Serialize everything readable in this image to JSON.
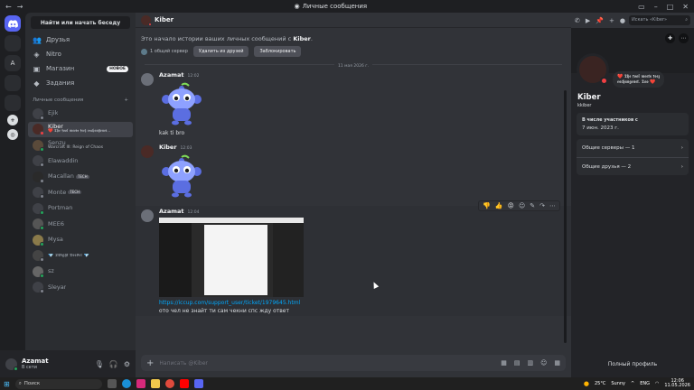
{
  "titlebar": {
    "title": "Личные сообщения"
  },
  "sidebar": {
    "search_button": "Найти или начать беседу",
    "nav": [
      {
        "label": "Друзья",
        "icon": "friends-icon"
      },
      {
        "label": "Nitro",
        "icon": "nitro-icon"
      },
      {
        "label": "Магазин",
        "icon": "shop-icon",
        "badge": "НОВОЕ"
      },
      {
        "label": "Задания",
        "icon": "quests-icon"
      }
    ],
    "dm_header": "Личные сообщения",
    "dms": [
      {
        "name": "Ejik",
        "status": "offline"
      },
      {
        "name": "Kiber",
        "sub": "❤️ 𝕿𝖍𝖊 𝖋𝖔𝖔𝖑 𝖒𝖊𝖊𝖙𝖘 𝖋𝖊𝖊𝖟 𝖊𝖘𝖈𝖍𝖆𝖓𝖌𝖊𝖓𝖊𝖙...",
        "status": "dnd",
        "active": true
      },
      {
        "name": "Senzu",
        "sub": "Warcraft III: Reign of Chaos",
        "status": "online"
      },
      {
        "name": "Elawaddin",
        "status": "offline"
      },
      {
        "name": "Macallan",
        "tag": "TECH",
        "status": "offline"
      },
      {
        "name": "Monte",
        "tag": "TECH",
        "status": "offline"
      },
      {
        "name": "Portman",
        "status": "online"
      },
      {
        "name": "MEE6",
        "status": "online"
      },
      {
        "name": "Mysa",
        "status": "online"
      },
      {
        "name": "💎 𝕯𝖜𝖎𝖌𝖍𝖙 𝕭𝖊𝖊𝖉𝖊𝖗 💎",
        "status": "offline"
      },
      {
        "name": "sz",
        "status": "online"
      },
      {
        "name": "Sleyar",
        "status": "offline"
      }
    ]
  },
  "user": {
    "name": "Azamat",
    "status": "В сети"
  },
  "chat": {
    "recipient": "Kiber",
    "intro_prefix": "Это начало истории ваших личных сообщений с ",
    "intro_name": "Kiber",
    "intro_suffix": ".",
    "mutual": "1 общий сервер",
    "remove_friend": "Удалить из друзей",
    "block": "Заблокировать",
    "date_divider": "11 мая 2026 г.",
    "messages": [
      {
        "author": "Azamat",
        "time": "12:02",
        "text": "kak ti bro"
      },
      {
        "author": "Kiber",
        "time": "12:03"
      },
      {
        "author": "Azamat",
        "time": "12:04",
        "link": "https://iccup.com/support_user/ticket/1979645.html",
        "text": "ото чел не знайт ти сам чекни  спс жду ответ"
      }
    ],
    "composer_placeholder": "Написать @Kiber"
  },
  "header": {
    "search_placeholder": "Искать «Kiber»"
  },
  "profile": {
    "name": "Kiber",
    "username": "kkiber",
    "bubble_line1": "❤️ 𝕿𝖍𝖊 𝖋𝖔𝖔𝖑 𝖒𝖊𝖊𝖙𝖘 𝖋𝖊𝖊𝖟",
    "bubble_line2": "𝖊𝖘𝖈𝖍𝖆𝖓𝖌𝖊𝖓𝖊𝖙. 𝕿𝖔𝖔 ❤️",
    "member_since_label": "В числе участников с",
    "member_since": "7 июн. 2023 г.",
    "mutual_servers": "Общие серверы — 1",
    "mutual_friends": "Общие друзья — 2",
    "full_profile": "Полный профиль"
  },
  "taskbar": {
    "search": "Поиск",
    "weather": "25°C",
    "weather_desc": "Sunny",
    "lang": "ENG",
    "time": "12:06",
    "date": "11.05.2026"
  },
  "colors": {
    "accent": "#5865f2",
    "online": "#23a55a",
    "dnd": "#f23f43",
    "link": "#00a8fc"
  }
}
